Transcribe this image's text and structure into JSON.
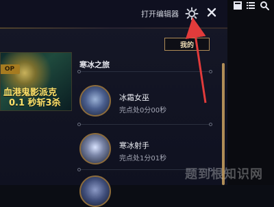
{
  "top_bar": {
    "open_editor_label": "打开编辑器",
    "icons": [
      "gear-icon",
      "close-icon"
    ]
  },
  "right_panel": {
    "icons": [
      "box-icon",
      "list-icon",
      "search-icon"
    ]
  },
  "profile_button": {
    "label": "我的"
  },
  "banner": {
    "badge": "OP",
    "line1": "血港鬼影派克",
    "line2": "0.1 秒斩3杀"
  },
  "section": {
    "title": "寒冰之旅"
  },
  "items": [
    {
      "name": "冰霜女巫",
      "status": "完点处0分00秒"
    },
    {
      "name": "寒冰射手",
      "status": "完点处1分01秒"
    }
  ],
  "watermark": "题到根知识网",
  "colors": {
    "accent_gold": "#b08d57",
    "annotation_red": "#e23b3b"
  }
}
